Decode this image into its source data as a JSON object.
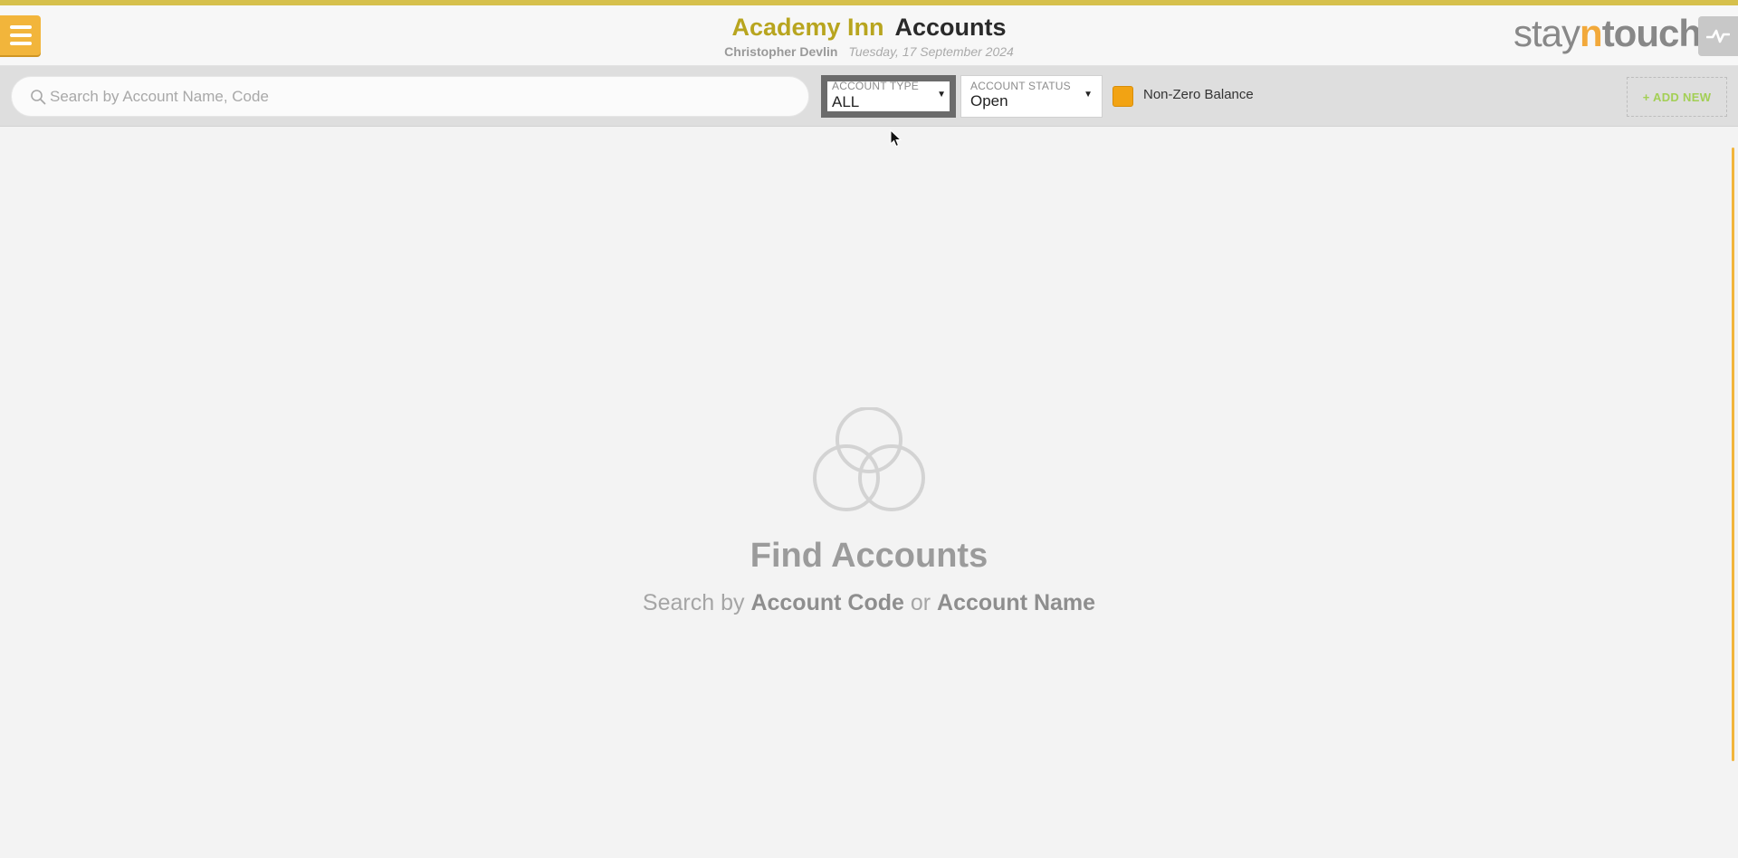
{
  "header": {
    "hotel_name": "Academy Inn",
    "page_title": "Accounts",
    "user_name": "Christopher Devlin",
    "date": "Tuesday, 17 September 2024",
    "logo": {
      "stay": "stay",
      "n": "n",
      "touch": "touch"
    }
  },
  "toolbar": {
    "search_placeholder": "Search by Account Name, Code",
    "search_value": "",
    "account_type": {
      "label": "ACCOUNT TYPE",
      "value": "ALL"
    },
    "account_status": {
      "label": "ACCOUNT STATUS",
      "value": "Open"
    },
    "non_zero_balance": {
      "label": "Non-Zero Balance",
      "checked": true
    },
    "add_new_label": "+ ADD NEW"
  },
  "empty_state": {
    "title": "Find Accounts",
    "sub_prefix": "Search by",
    "sub_term1": "Account Code",
    "sub_or": "or",
    "sub_term2": "Account Name"
  },
  "colors": {
    "accent": "#f2b53b",
    "hotel_name": "#b8a51f",
    "add_new": "#a3cf55",
    "checkbox": "#f2a313",
    "top_stripe": "#d6c04c"
  },
  "icons": {
    "menu": "hamburger-icon",
    "search": "search-icon",
    "pulse": "activity-pulse-icon",
    "empty": "three-circles-icon",
    "caret": "caret-down-icon"
  }
}
